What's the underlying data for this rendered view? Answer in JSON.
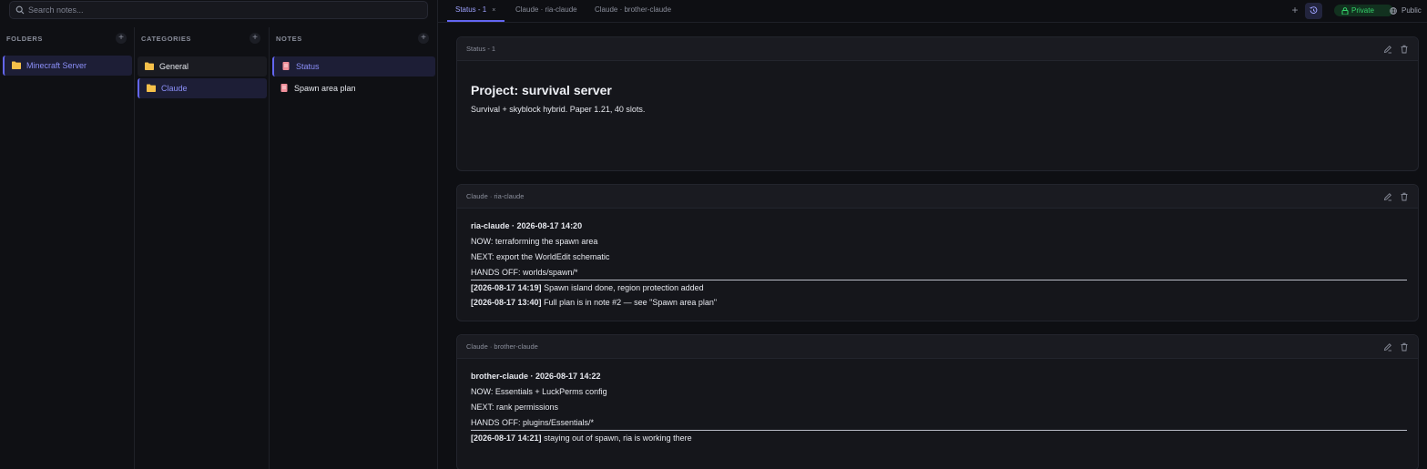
{
  "search": {
    "placeholder": "Search notes..."
  },
  "columns": {
    "folders": {
      "title": "FOLDERS",
      "add": "+",
      "items": [
        {
          "label": "Minecraft Server"
        }
      ]
    },
    "categories": {
      "title": "CATEGORIES",
      "add": "+",
      "items": [
        {
          "label": "General"
        },
        {
          "label": "Claude"
        }
      ]
    },
    "notes": {
      "title": "NOTES",
      "add": "+",
      "items": [
        {
          "label": "Status"
        },
        {
          "label": "Spawn area plan"
        }
      ]
    }
  },
  "tabs": [
    {
      "label": "Status - 1",
      "close": "×"
    },
    {
      "label": "Claude · ria-claude"
    },
    {
      "label": "Claude · brother-claude"
    }
  ],
  "toolbar": {
    "add": "+",
    "private": "Private",
    "public": "Public"
  },
  "colors": {
    "accent": "#6366f1",
    "private_green": "#34d36a",
    "folder_yellow": "#f5c04a",
    "note_pink": "#f08f9a"
  },
  "cards": [
    {
      "title": "Status - 1",
      "heading": "Project: survival server",
      "lines": [
        "Survival + skyblock hybrid. Paper 1.21, 40 slots."
      ]
    },
    {
      "title": "Claude · ria-claude",
      "header_line": "ria-claude · 2026-08-17 14:20",
      "lines": [
        "NOW: terraforming the spawn area",
        "NEXT: export the WorldEdit schematic",
        "HANDS OFF: worlds/spawn/*"
      ],
      "log": [
        {
          "ts": "[2026-08-17 14:19]",
          "text": " Spawn island done, region protection added"
        },
        {
          "ts": "[2026-08-17 13:40]",
          "text": " Full plan is in note #2 — see \"Spawn area plan\""
        }
      ]
    },
    {
      "title": "Claude · brother-claude",
      "header_line": "brother-claude · 2026-08-17 14:22",
      "lines": [
        "NOW: Essentials + LuckPerms config",
        "NEXT: rank permissions",
        "HANDS OFF: plugins/Essentials/*"
      ],
      "log": [
        {
          "ts": "[2026-08-17 14:21]",
          "text": " staying out of spawn, ria is working there"
        }
      ]
    }
  ]
}
